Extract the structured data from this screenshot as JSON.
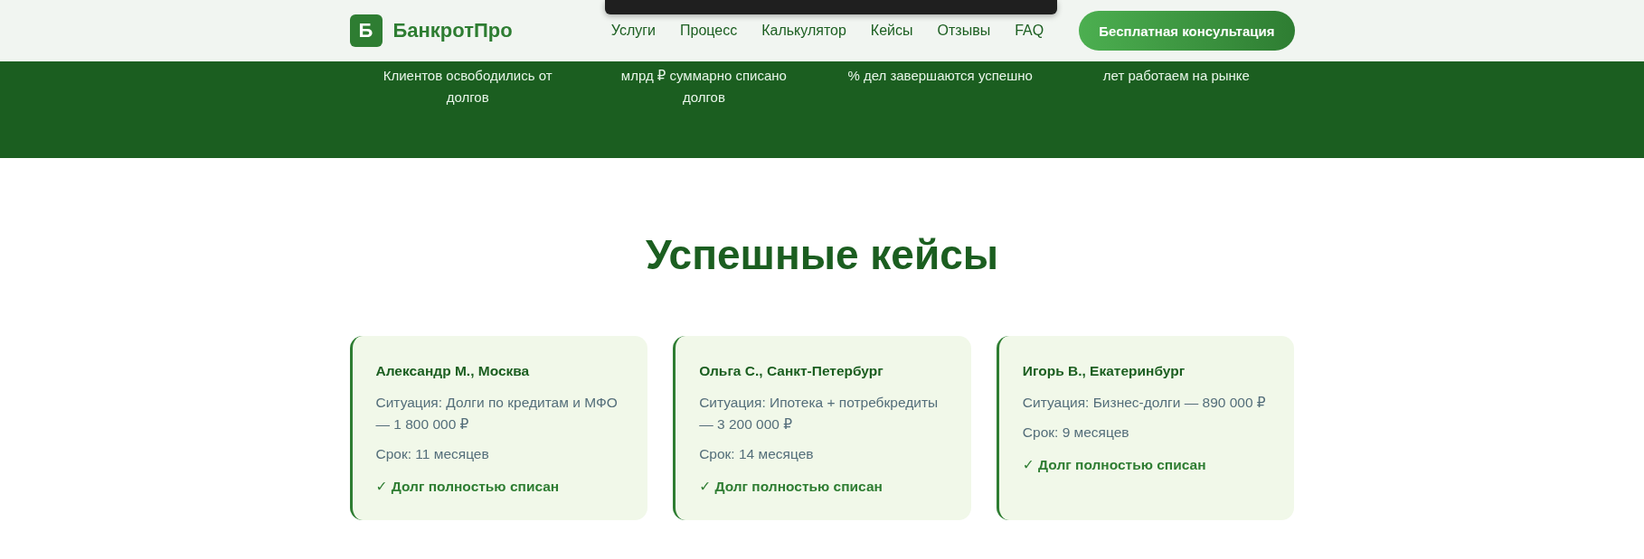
{
  "header": {
    "logo_letter": "Б",
    "brand": "БанкротПро",
    "nav": [
      {
        "label": "Услуги"
      },
      {
        "label": "Процесс"
      },
      {
        "label": "Калькулятор"
      },
      {
        "label": "Кейсы"
      },
      {
        "label": "Отзывы"
      },
      {
        "label": "FAQ"
      }
    ],
    "cta": "Бесплатная консультация"
  },
  "stats": [
    {
      "caption": "Клиентов освободились от долгов"
    },
    {
      "caption": "млрд ₽ суммарно списано долгов"
    },
    {
      "caption": "% дел завершаются успешно"
    },
    {
      "caption": "лет работаем на рынке"
    }
  ],
  "cases": {
    "title": "Успешные кейсы",
    "items": [
      {
        "client": "Александр М., Москва",
        "situation": "Ситуация: Долги по кредитам и МФО — 1 800 000 ₽",
        "term": "Срок: 11 месяцев",
        "result": "✓ Долг полностью списан"
      },
      {
        "client": "Ольга С., Санкт-Петербург",
        "situation": "Ситуация: Ипотека + потребкредиты — 3 200 000 ₽",
        "term": "Срок: 14 месяцев",
        "result": "✓ Долг полностью списан"
      },
      {
        "client": "Игорь В., Екатеринбург",
        "situation": "Ситуация: Бизнес-долги — 890 000 ₽",
        "term": "Срок: 9 месяцев",
        "result": "✓ Долг полностью списан"
      }
    ]
  }
}
